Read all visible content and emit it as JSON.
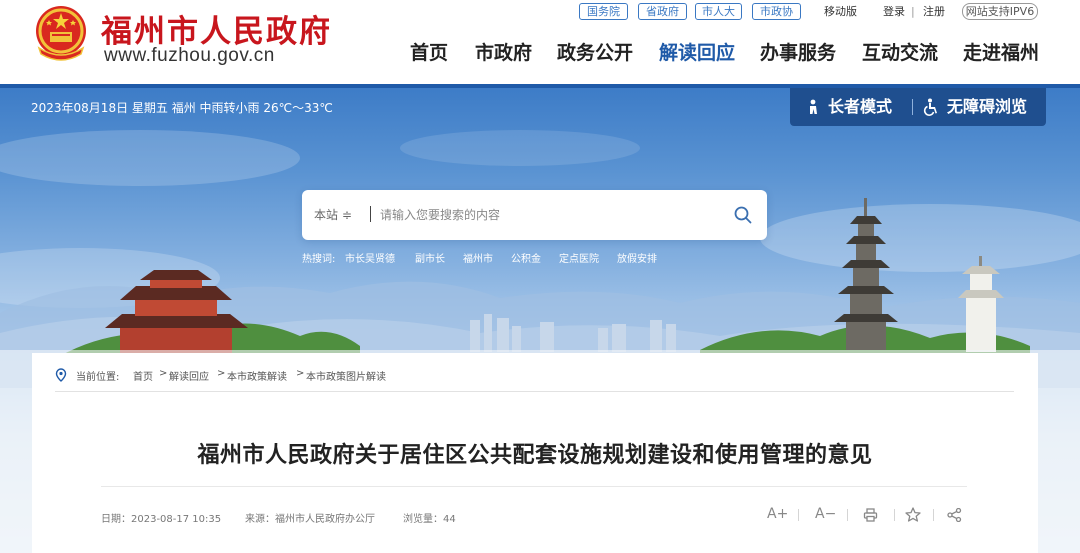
{
  "header": {
    "site_name": "福州市人民政府",
    "site_url": "www.fuzhou.gov.cn",
    "top_links": [
      "国务院",
      "省政府",
      "市人大",
      "市政协"
    ],
    "mobile": "移动版",
    "login": "登录",
    "divider": "|",
    "register": "注册",
    "ipv6": "网站支持IPV6"
  },
  "nav": {
    "items": [
      "首页",
      "市政府",
      "政务公开",
      "解读回应",
      "办事服务",
      "互动交流",
      "走进福州"
    ],
    "active": "解读回应"
  },
  "banner": {
    "weather": "2023年08月18日 星期五  福州 中雨转小雨 26℃～33℃",
    "elder_mode": "长者模式",
    "accessible": "无障碍浏览"
  },
  "search": {
    "scope": "本站 ≑",
    "placeholder": "请输入您要搜索的内容",
    "hot_label": "热搜词:",
    "hot_words": [
      "市长吴贤德",
      "副市长",
      "福州市",
      "公积金",
      "定点医院",
      "放假安排"
    ]
  },
  "breadcrumb": {
    "label": "当前位置:",
    "items": [
      "首页",
      "解读回应",
      "本市政策解读",
      "本市政策图片解读"
    ],
    "separator": ">"
  },
  "article": {
    "title": "福州市人民政府关于居住区公共配套设施规划建设和使用管理的意见",
    "date": "日期：2023-08-17 10:35",
    "source": "来源：福州市人民政府办公厅",
    "views": "浏览量：44"
  },
  "tools": {
    "font_up": "A+",
    "font_down": "A−",
    "print_icon": "printer-icon",
    "favorite_icon": "star-icon",
    "share_icon": "share-icon"
  },
  "colors": {
    "brand_red": "#c8161d",
    "brand_blue": "#1f5aa8",
    "access_bar": "#1f4f8f"
  }
}
